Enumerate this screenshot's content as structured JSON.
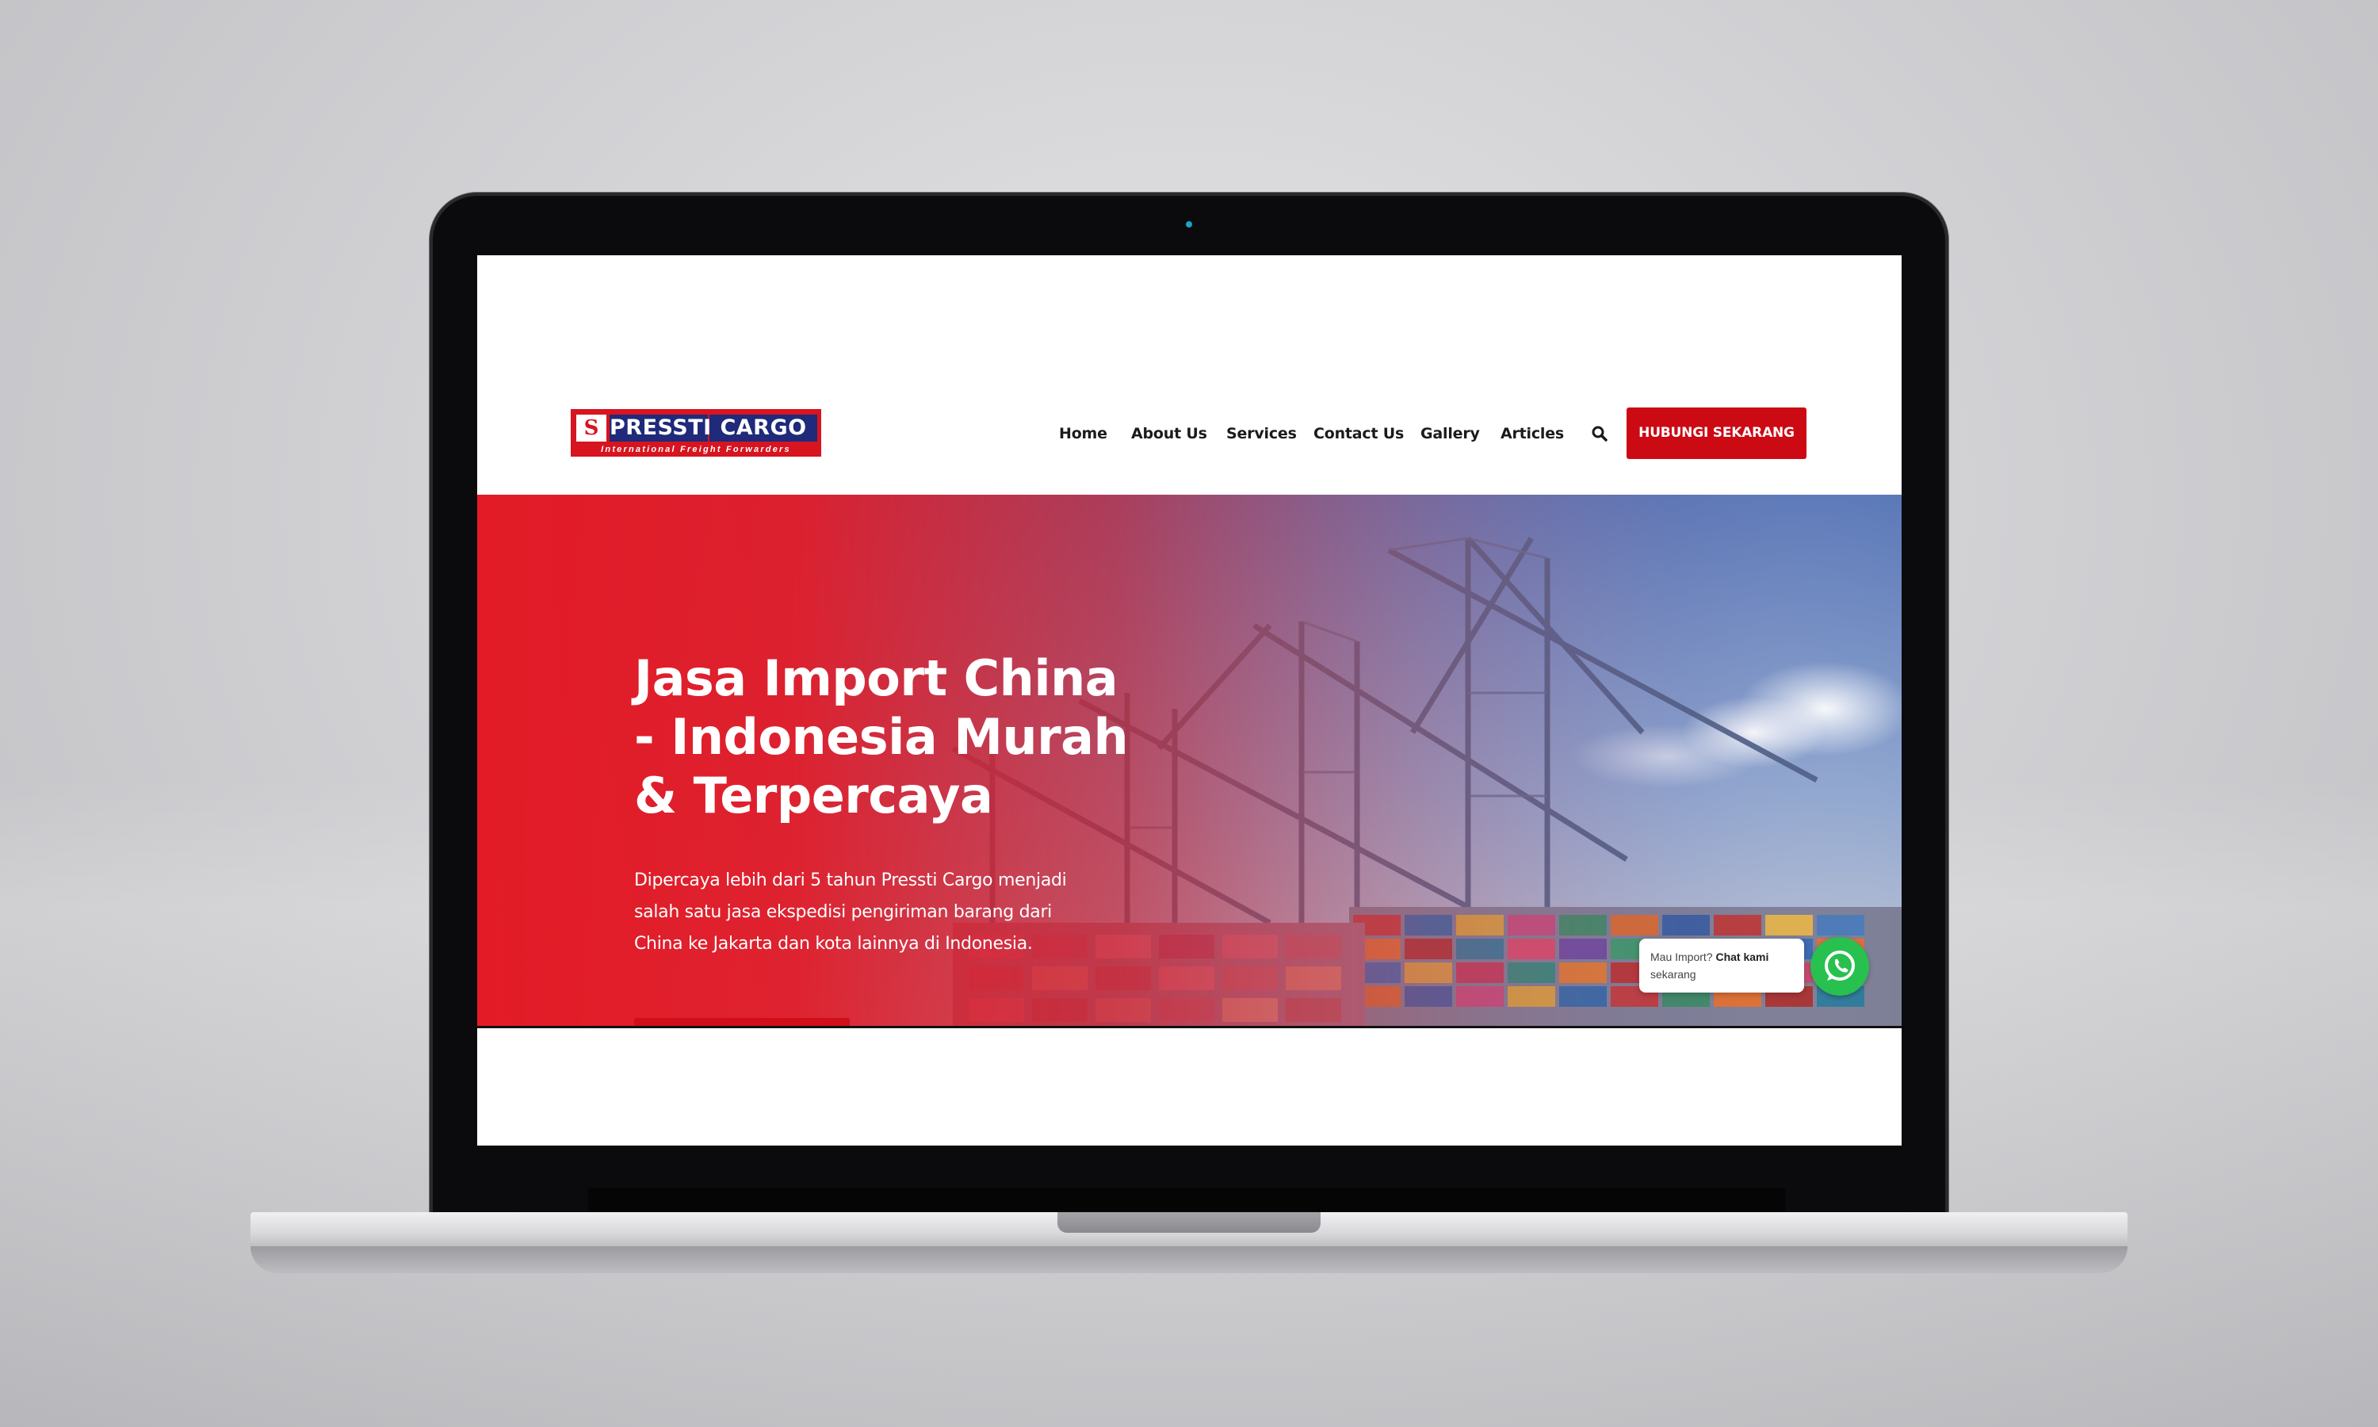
{
  "site": {
    "logo": {
      "word1": "PRESSTI",
      "word2": "CARGO",
      "tagline": "International Freight Forwarders",
      "emblem": "S"
    },
    "nav": {
      "items": [
        {
          "label": "Home"
        },
        {
          "label": "About Us"
        },
        {
          "label": "Services"
        },
        {
          "label": "Contact Us"
        },
        {
          "label": "Gallery"
        },
        {
          "label": "Articles"
        }
      ],
      "search_icon": "search-icon",
      "cta_label": "HUBUNGI SEKARANG"
    },
    "hero": {
      "title_lines": [
        "Jasa Import China",
        "- Indonesia Murah",
        "& Terpercaya"
      ],
      "description_lines": [
        "Dipercaya lebih dari 5 tahun Pressti Cargo menjadi",
        "salah satu jasa ekspedisi pengiriman barang dari",
        "China ke Jakarta dan kota lainnya di Indonesia."
      ]
    },
    "whatsapp": {
      "prompt": "Mau Import?",
      "action": "Chat kami",
      "action_line2": "sekarang",
      "icon": "whatsapp-icon"
    }
  },
  "colors": {
    "brand_red": "#cc0a14",
    "brand_navy": "#1f2a7a",
    "whatsapp_green": "#28c04f",
    "background": "#d2d2d5"
  }
}
